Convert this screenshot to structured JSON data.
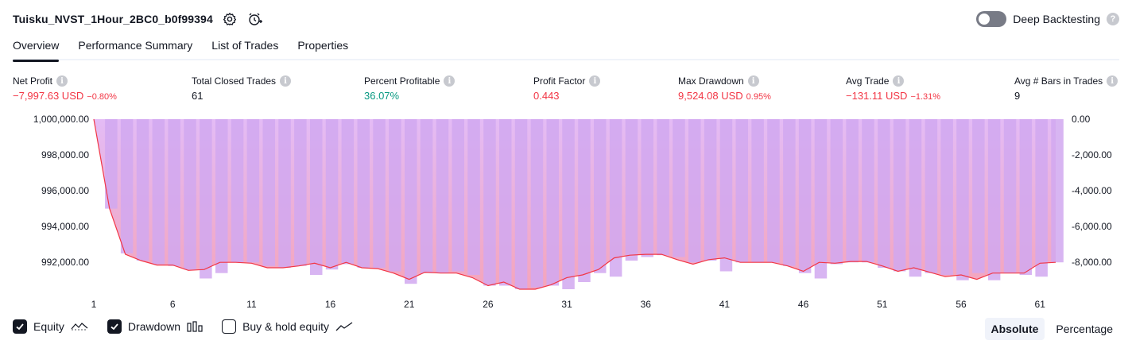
{
  "header": {
    "strategy_name": "Tuisku_NVST_1Hour_2BC0_b0f99394",
    "deep_backtesting_label": "Deep Backtesting",
    "help_glyph": "?"
  },
  "tabs": [
    {
      "label": "Overview",
      "active": true
    },
    {
      "label": "Performance Summary",
      "active": false
    },
    {
      "label": "List of Trades",
      "active": false
    },
    {
      "label": "Properties",
      "active": false
    }
  ],
  "metrics": {
    "info_glyph": "i",
    "net_profit": {
      "label": "Net Profit",
      "value": "−7,997.63 USD",
      "sub": "−0.80%"
    },
    "total_closed_trades": {
      "label": "Total Closed Trades",
      "value": "61"
    },
    "percent_profitable": {
      "label": "Percent Profitable",
      "value": "36.07%"
    },
    "profit_factor": {
      "label": "Profit Factor",
      "value": "0.443"
    },
    "max_drawdown": {
      "label": "Max Drawdown",
      "value": "9,524.08 USD",
      "sub": "0.95%"
    },
    "avg_trade": {
      "label": "Avg Trade",
      "value": "−131.11 USD",
      "sub": "−1.31%"
    },
    "avg_bars": {
      "label": "Avg # Bars in Trades",
      "value": "9"
    }
  },
  "colors": {
    "negative": "#f23645",
    "positive": "#089981",
    "equity_line": "#f23645",
    "drawdown_bar": "#d1a8f0",
    "fill_top": "#e2b8f5",
    "fill_bottom": "#f4a0b8"
  },
  "chart_data": {
    "type": "area",
    "x_ticks": [
      1,
      6,
      11,
      16,
      21,
      26,
      31,
      36,
      41,
      46,
      51,
      56,
      61
    ],
    "left_axis": {
      "ticks": [
        "1,000,000.00",
        "998,000.00",
        "996,000.00",
        "994,000.00",
        "992,000.00"
      ],
      "ylim": [
        990500,
        1000000
      ]
    },
    "right_axis": {
      "ticks": [
        "0.00",
        "-2,000.00",
        "-4,000.00",
        "-6,000.00",
        "-8,000.00"
      ],
      "ylim": [
        -9500,
        0
      ]
    },
    "series": [
      {
        "name": "Equity",
        "x": [
          1,
          2,
          3,
          4,
          5,
          6,
          7,
          8,
          9,
          10,
          11,
          12,
          13,
          14,
          15,
          16,
          17,
          18,
          19,
          20,
          21,
          22,
          23,
          24,
          25,
          26,
          27,
          28,
          29,
          30,
          31,
          32,
          33,
          34,
          35,
          36,
          37,
          38,
          39,
          40,
          41,
          42,
          43,
          44,
          45,
          46,
          47,
          48,
          49,
          50,
          51,
          52,
          53,
          54,
          55,
          56,
          57,
          58,
          59,
          60,
          61,
          62
        ],
        "values": [
          1000000,
          995000,
          992450,
          992100,
          991850,
          991850,
          991550,
          991600,
          992000,
          992000,
          991950,
          991700,
          991700,
          991800,
          991950,
          991700,
          992000,
          991700,
          991650,
          991400,
          991050,
          991450,
          991400,
          991400,
          991150,
          990700,
          990900,
          990500,
          990500,
          990750,
          991150,
          991300,
          991600,
          992250,
          992400,
          992450,
          992450,
          992150,
          991900,
          992150,
          992250,
          992000,
          992000,
          992000,
          991800,
          991500,
          992000,
          991950,
          992050,
          992050,
          991800,
          991500,
          991700,
          991450,
          991200,
          991300,
          991050,
          991400,
          991400,
          991400,
          991950,
          992000
        ]
      },
      {
        "name": "Drawdown",
        "x": [
          1,
          2,
          3,
          4,
          5,
          6,
          7,
          8,
          9,
          10,
          11,
          12,
          13,
          14,
          15,
          16,
          17,
          18,
          19,
          20,
          21,
          22,
          23,
          24,
          25,
          26,
          27,
          28,
          29,
          30,
          31,
          32,
          33,
          34,
          35,
          36,
          37,
          38,
          39,
          40,
          41,
          42,
          43,
          44,
          45,
          46,
          47,
          48,
          49,
          50,
          51,
          52,
          53,
          54,
          55,
          56,
          57,
          58,
          59,
          60,
          61,
          62
        ],
        "values": [
          0,
          -5000,
          -7500,
          -7900,
          -8100,
          -8200,
          -8400,
          -8900,
          -8600,
          -8000,
          -8000,
          -8200,
          -8300,
          -8200,
          -8700,
          -8400,
          -8100,
          -8300,
          -8300,
          -8500,
          -9200,
          -8600,
          -8600,
          -8500,
          -8700,
          -9300,
          -9300,
          -9500,
          -9400,
          -9300,
          -9500,
          -9100,
          -8600,
          -8800,
          -7900,
          -7700,
          -7600,
          -7700,
          -8000,
          -7900,
          -8500,
          -8000,
          -8000,
          -8000,
          -8200,
          -8600,
          -8900,
          -8100,
          -8000,
          -8000,
          -8300,
          -8500,
          -8800,
          -8600,
          -8700,
          -9000,
          -8600,
          -9000,
          -8600,
          -8700,
          -8800,
          -8000
        ]
      }
    ],
    "ylim": [
      990500,
      1000000
    ]
  },
  "legend": {
    "equity_label": "Equity",
    "drawdown_label": "Drawdown",
    "buy_hold_label": "Buy & hold equity"
  },
  "mode": {
    "absolute_label": "Absolute",
    "percentage_label": "Percentage"
  }
}
